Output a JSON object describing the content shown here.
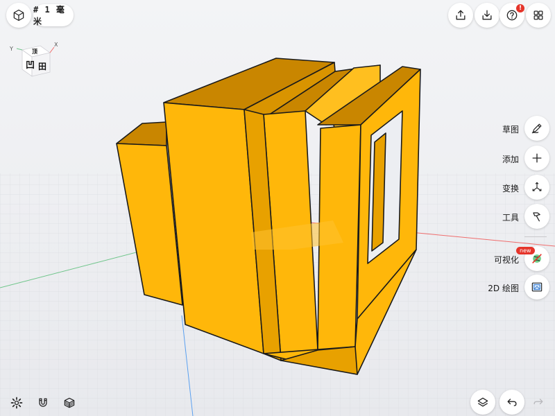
{
  "toolbar_top": {
    "unit_label": "# 1 毫米",
    "help_badge": "!"
  },
  "side_tools": {
    "sketch": "草图",
    "add": "添加",
    "transform": "变换",
    "tools": "工具",
    "visualize": "可视化",
    "visualize_badge": "new",
    "drawing2d": "2D 绘图"
  },
  "view_cube": {
    "axis_x": "X",
    "axis_y": "Y"
  },
  "colors": {
    "model_front": "#ffb70a",
    "model_side": "#e8a100",
    "model_top": "#c98600",
    "axis_red": "#ef6c6c",
    "axis_green": "#6fc58a",
    "axis_blue": "#5aa0f0"
  }
}
